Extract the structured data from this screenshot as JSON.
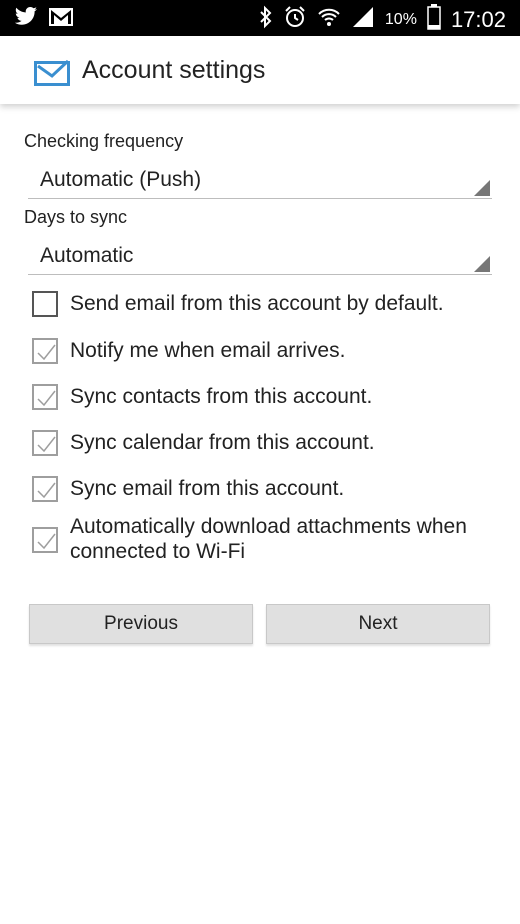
{
  "status_bar": {
    "left_icons": [
      "twitter-icon",
      "gmail-icon"
    ],
    "right_icons": [
      "bluetooth-icon",
      "alarm-icon",
      "wifi-icon",
      "signal-icon"
    ],
    "battery": "10%",
    "time": "17:02"
  },
  "action_bar": {
    "icon": "email-icon",
    "title": "Account settings"
  },
  "form": {
    "checking_frequency_label": "Checking frequency",
    "checking_frequency_value": "Automatic (Push)",
    "days_to_sync_label": "Days to sync",
    "days_to_sync_value": "Automatic",
    "options": [
      {
        "label": "Send email from this account by default.",
        "checked": false
      },
      {
        "label": "Notify me when email arrives.",
        "checked": true
      },
      {
        "label": "Sync contacts from this account.",
        "checked": true
      },
      {
        "label": "Sync calendar from this account.",
        "checked": true
      },
      {
        "label": "Sync email from this account.",
        "checked": true
      },
      {
        "label": "Automatically download attachments when connected to Wi-Fi",
        "checked": true
      }
    ]
  },
  "buttons": {
    "previous": "Previous",
    "next": "Next"
  },
  "colors": {
    "status_bar": "#000000",
    "accent": "#3a8fd0",
    "checkmark": "#9e9e9e"
  }
}
